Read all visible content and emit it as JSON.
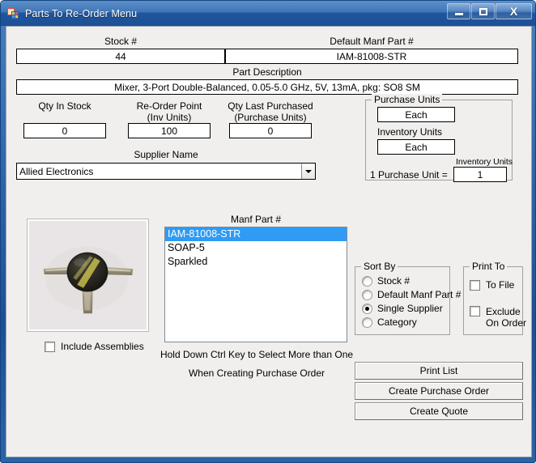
{
  "window": {
    "title": "Parts To Re-Order Menu",
    "icon": "vb-app-icon",
    "controls": {
      "minimize": "minimize-button",
      "maximize": "maximize-button",
      "close": "close-button",
      "close_glyph": "X"
    },
    "accent_color": "#1d4f95",
    "client_background": "#f0efed"
  },
  "fields": {
    "stock_number": {
      "label": "Stock #",
      "value": "44"
    },
    "default_manf_part": {
      "label": "Default Manf Part #",
      "value": "IAM-81008-STR"
    },
    "part_description": {
      "label": "Part Description",
      "value": "Mixer, 3-Port Double-Balanced, 0.05-5.0 GHz, 5V, 13mA, pkg: SO8 SM"
    },
    "qty_in_stock": {
      "label": "Qty In Stock",
      "value": "0"
    },
    "reorder_point": {
      "label_line1": "Re-Order Point",
      "label_line2": "(Inv Units)",
      "value": "100"
    },
    "qty_last_purchased": {
      "label_line1": "Qty Last Purchased",
      "label_line2": "(Purchase Units)",
      "value": "0"
    },
    "supplier_name": {
      "label": "Supplier Name",
      "value": "Allied Electronics",
      "options": [
        "Allied Electronics"
      ]
    }
  },
  "units_group": {
    "title": "Purchase Units",
    "purchase_units_value": "Each",
    "inventory_units_label": "Inventory Units",
    "inventory_units_value": "Each",
    "conversion_caption": "Inventory Units",
    "conversion_label": "1 Purchase Unit =",
    "conversion_value": "1"
  },
  "manf_part_list": {
    "label": "Manf Part #",
    "items": [
      {
        "text": "IAM-81008-STR",
        "selected": true
      },
      {
        "text": "SOAP-5",
        "selected": false
      },
      {
        "text": "Sparkled",
        "selected": false
      }
    ],
    "hint_line1": "Hold Down Ctrl Key to Select More than One",
    "hint_line2": "When Creating Purchase Order",
    "selection_color": "#2f9bf4"
  },
  "photo": {
    "name": "part-photo",
    "alt": "photograph of 3-lead electronic component"
  },
  "include_assemblies": {
    "label": "Include Assemblies",
    "checked": false
  },
  "sort_by": {
    "title": "Sort By",
    "options": [
      {
        "label": "Stock #",
        "selected": false
      },
      {
        "label": "Default Manf Part #",
        "selected": false
      },
      {
        "label": "Single Supplier",
        "selected": true
      },
      {
        "label": "Category",
        "selected": false
      }
    ]
  },
  "print_to": {
    "title": "Print To",
    "options": [
      {
        "label": "To File",
        "label_line2": "",
        "checked": false
      },
      {
        "label": "Exclude",
        "label_line2": "On Order",
        "checked": false
      }
    ]
  },
  "actions": {
    "print_list": "Print List",
    "create_purchase_order": "Create Purchase Order",
    "create_quote": "Create Quote"
  }
}
